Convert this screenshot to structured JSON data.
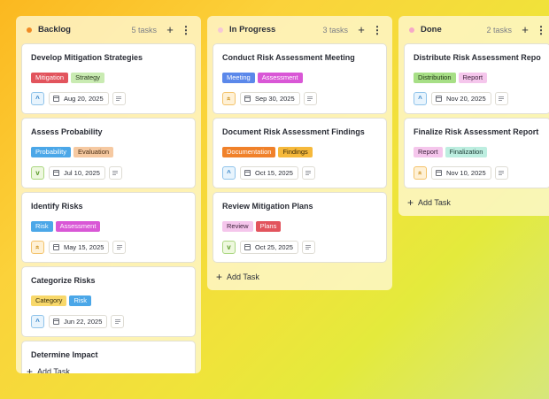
{
  "colors": {
    "backlog_dot": "#f08a24",
    "progress_dot": "#f6c8d8",
    "done_dot": "#f6a8c8"
  },
  "columns": [
    {
      "key": "backlog",
      "title": "Backlog",
      "count": "5 tasks",
      "add_label": "Add Task",
      "cards": [
        {
          "title": "Develop Mitigation Strategies",
          "tags": [
            "Mitigation",
            "Strategy"
          ],
          "priority": "chevron-up-icon",
          "date": "Aug 20, 2025"
        },
        {
          "title": "Assess Probability",
          "tags": [
            "Probability",
            "Evaluation"
          ],
          "priority": "chevron-down-icon",
          "date": "Jul 10, 2025"
        },
        {
          "title": "Identify Risks",
          "tags": [
            "Risk",
            "Assessment"
          ],
          "priority": "double-chevron-up-icon",
          "date": "May 15, 2025"
        },
        {
          "title": "Categorize Risks",
          "tags": [
            "Category",
            "Risk"
          ],
          "priority": "chevron-up-icon",
          "date": "Jun 22, 2025"
        },
        {
          "title": "Determine Impact",
          "tags": [],
          "priority": "",
          "date": ""
        }
      ]
    },
    {
      "key": "progress",
      "title": "In Progress",
      "count": "3 tasks",
      "add_label": "Add Task",
      "cards": [
        {
          "title": "Conduct Risk Assessment Meeting",
          "tags": [
            "Meeting",
            "Assessment"
          ],
          "priority": "double-chevron-up-icon",
          "date": "Sep 30, 2025"
        },
        {
          "title": "Document Risk Assessment Findings",
          "tags": [
            "Documentation",
            "Findings"
          ],
          "priority": "chevron-up-icon",
          "date": "Oct 15, 2025"
        },
        {
          "title": "Review Mitigation Plans",
          "tags": [
            "Review",
            "Plans"
          ],
          "priority": "chevron-down-icon",
          "date": "Oct 25, 2025"
        }
      ]
    },
    {
      "key": "done",
      "title": "Done",
      "count": "2 tasks",
      "add_label": "Add Task",
      "cards": [
        {
          "title": "Distribute Risk Assessment Report",
          "tags": [
            "Distribution",
            "Report"
          ],
          "priority": "chevron-up-icon",
          "date": "Nov 20, 2025"
        },
        {
          "title": "Finalize Risk Assessment Report",
          "tags": [
            "Report",
            "Finalization"
          ],
          "priority": "double-chevron-up-icon",
          "date": "Nov 10, 2025"
        }
      ]
    }
  ],
  "tag_colors": {
    "Mitigation": [
      "#e2545d",
      "#ffffff"
    ],
    "Strategy": [
      "#c9ebb2",
      "#2a3a1e"
    ],
    "Probability": [
      "#4ba7e8",
      "#ffffff"
    ],
    "Evaluation": [
      "#f6c9a1",
      "#4a2e14"
    ],
    "Risk": [
      "#4ba7e8",
      "#ffffff"
    ],
    "Assessment": [
      "#d957d6",
      "#ffffff"
    ],
    "Category": [
      "#f8d86a",
      "#3a3010"
    ],
    "Meeting": [
      "#5b88ea",
      "#ffffff"
    ],
    "Documentation": [
      "#f0812a",
      "#ffffff"
    ],
    "Findings": [
      "#f6b93b",
      "#3a2a08"
    ],
    "Review": [
      "#f5c6ec",
      "#3a1f38"
    ],
    "Plans": [
      "#e2545d",
      "#ffffff"
    ],
    "Distribution": [
      "#a7df86",
      "#1f3315"
    ],
    "Report": [
      "#f5c6ec",
      "#3a1f38"
    ],
    "Finalization": [
      "#bdeee0",
      "#1a3a33"
    ]
  },
  "priority_styles": {
    "chevron-up-icon": {
      "glyph": "^",
      "bg": "#e8f4fd",
      "border": "#8fc3ea",
      "fg": "#2f7fc4"
    },
    "chevron-down-icon": {
      "glyph": "v",
      "bg": "#eef8df",
      "border": "#a9d67f",
      "fg": "#5a9a2a"
    },
    "double-chevron-up-icon": {
      "glyph": "«",
      "bg": "#fff1d6",
      "border": "#f3c26a",
      "fg": "#c98a12"
    }
  }
}
